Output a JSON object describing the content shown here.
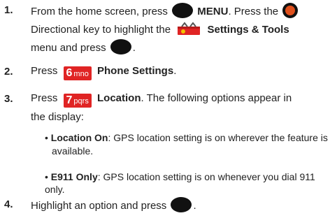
{
  "steps": [
    {
      "num": "1.",
      "line1_a": "From the home screen, press",
      "line1_b": "MENU",
      "line1_c": ". Press the",
      "line2_a": "Directional key to highlight the",
      "line2_b": "Settings & Tools",
      "line3_a": "menu and press",
      "line3_b": "."
    },
    {
      "num": "2.",
      "a": "Press",
      "key_digit": "6",
      "key_letters": "mno",
      "b": "Phone Settings",
      "c": "."
    },
    {
      "num": "3.",
      "a": "Press",
      "key_digit": "7",
      "key_letters": "pqrs",
      "b": "Location",
      "c": ". The following options appear in",
      "line2": "the display:"
    },
    {
      "num": "4.",
      "a": "Highlight an option and press",
      "b": "."
    }
  ],
  "options": [
    {
      "label": "Location On",
      "text": ": GPS location setting is on wherever the feature is",
      "text2": "available."
    },
    {
      "label": "E911 Only",
      "text": ": GPS location setting is on whenever you dial 911 only."
    }
  ],
  "colors": {
    "key": "#111111",
    "nav_ring": "#e0501c",
    "number_key": "#e02424"
  },
  "icons": [
    "menu-key-icon",
    "directional-key-icon",
    "settings-tools-icon",
    "ok-key-icon",
    "number-key-6-icon",
    "number-key-7-icon"
  ]
}
